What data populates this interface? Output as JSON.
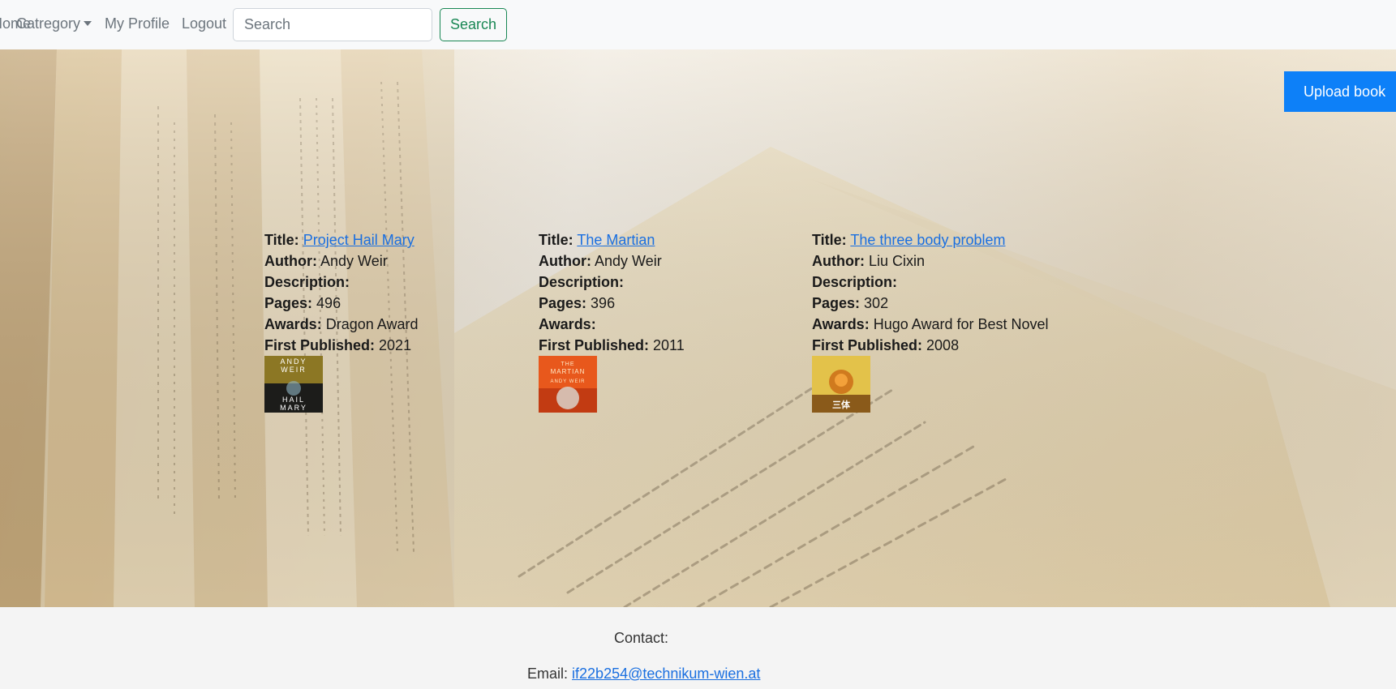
{
  "nav": {
    "home_label": "Home",
    "category_label": "Catregory",
    "profile_label": "My Profile",
    "logout_label": "Logout",
    "search_placeholder": "Search",
    "search_button_label": "Search"
  },
  "actions": {
    "upload_label": "Upload book"
  },
  "field_labels": {
    "title": "Title:",
    "author": "Author:",
    "description": "Description:",
    "pages": "Pages:",
    "awards": "Awards:",
    "first_published": "First Published:"
  },
  "books": [
    {
      "title": "Project Hail Mary",
      "author": "Andy Weir",
      "description": "",
      "pages": "496",
      "awards": "Dragon Award",
      "first_published": "2021",
      "cover_lines": [
        "ANDY",
        "WEIR",
        "HAIL",
        "MARY"
      ]
    },
    {
      "title": "The Martian",
      "author": "Andy Weir",
      "description": "",
      "pages": "396",
      "awards": "",
      "first_published": "2011",
      "cover_lines": [
        "THE",
        "MARTIAN",
        "ANDY WEIR"
      ]
    },
    {
      "title": "The three body problem",
      "author": "Liu Cixin",
      "description": "",
      "pages": "302",
      "awards": "Hugo Award for Best Novel",
      "first_published": "2008",
      "cover_lines": [
        "三体"
      ]
    }
  ],
  "footer": {
    "contact_label": "Contact:",
    "email_label": "Email:",
    "email": "if22b254@technikum-wien.at"
  },
  "colors": {
    "accent_blue": "#0d80f8",
    "link_blue": "#1a6fe0",
    "search_green": "#198754"
  },
  "icons": {
    "category_dropdown": "caret-down-icon"
  }
}
